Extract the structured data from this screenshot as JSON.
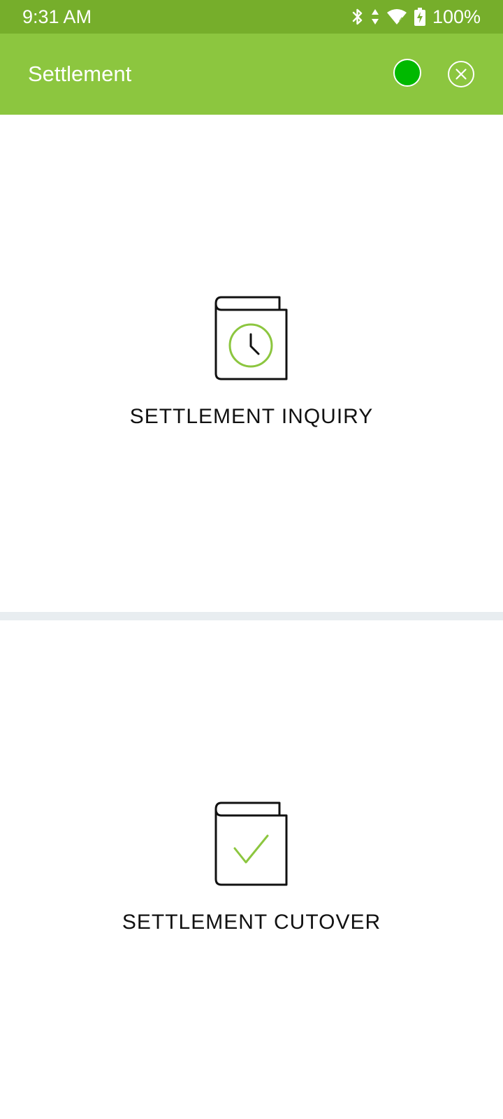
{
  "status_bar": {
    "time": "9:31 AM",
    "battery": "100%",
    "icons": [
      "bluetooth-icon",
      "data-arrows-icon",
      "wifi-icon",
      "battery-charging-icon"
    ]
  },
  "app_bar": {
    "title": "Settlement",
    "connection_status_color": "#00b900",
    "background_color": "#8cc63f",
    "close_icon": "close-circle-icon"
  },
  "options": [
    {
      "label": "SETTLEMENT INQUIRY",
      "icon": "book-clock-icon"
    },
    {
      "label": "SETTLEMENT CUTOVER",
      "icon": "book-check-icon"
    }
  ],
  "colors": {
    "accent": "#8cc63f",
    "status_bar": "#76ae2b",
    "divider": "#e8edf0"
  }
}
